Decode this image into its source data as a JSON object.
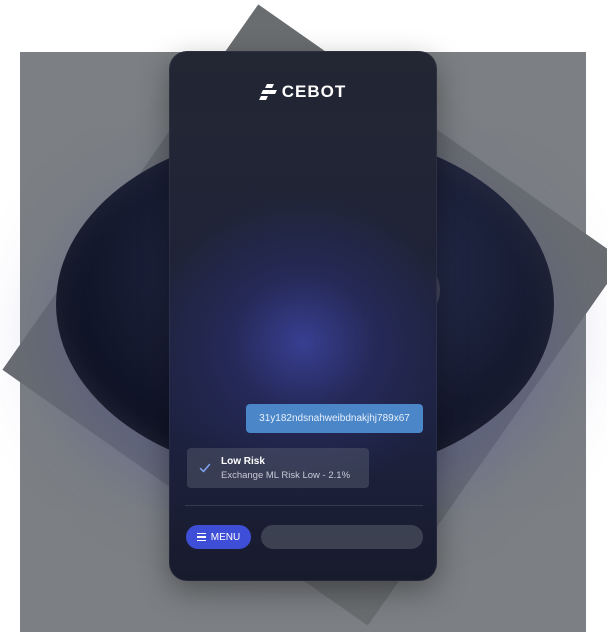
{
  "brand": {
    "name": "CEBOT",
    "logo_icon": "chevron-stack-icon",
    "text_color": "#ffffff"
  },
  "chat": {
    "address": "31y182ndsnahweibdnakjhj789x67",
    "address_bubble_color": "#4a86c8"
  },
  "risk": {
    "icon": "check-icon",
    "title": "Low Risk",
    "detail": "Exchange ML Risk Low - 2.1%"
  },
  "footer": {
    "menu_label": "MENU",
    "menu_icon": "hamburger-icon",
    "menu_color": "#3f4ed6",
    "input_placeholder": ""
  }
}
